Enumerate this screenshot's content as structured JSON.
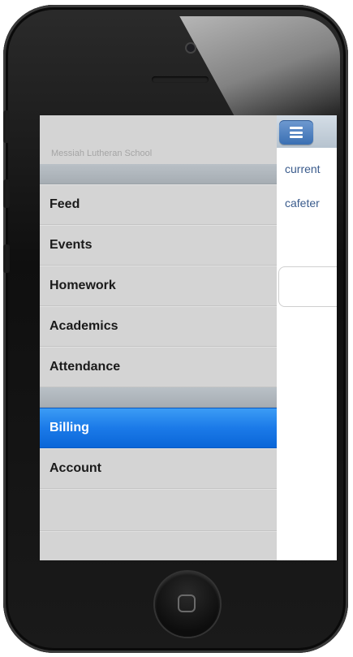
{
  "device": {
    "type": "iphone"
  },
  "drawer": {
    "school_name": "Messiah Lutheran School",
    "items": [
      {
        "label": "Feed",
        "active": false
      },
      {
        "label": "Events",
        "active": false
      },
      {
        "label": "Homework",
        "active": false
      },
      {
        "label": "Academics",
        "active": false
      },
      {
        "label": "Attendance",
        "active": false
      }
    ],
    "items_group2": [
      {
        "label": "Billing",
        "active": true
      },
      {
        "label": "Account",
        "active": false
      }
    ]
  },
  "content": {
    "menu_icon": "hamburger-icon",
    "line1": "current",
    "line2": "cafeter"
  },
  "colors": {
    "active_item": "#1b7ae8",
    "drawer_bg": "#d4d4d4",
    "link_text": "#3a5b8c",
    "menu_button": "#3a6fb3"
  }
}
